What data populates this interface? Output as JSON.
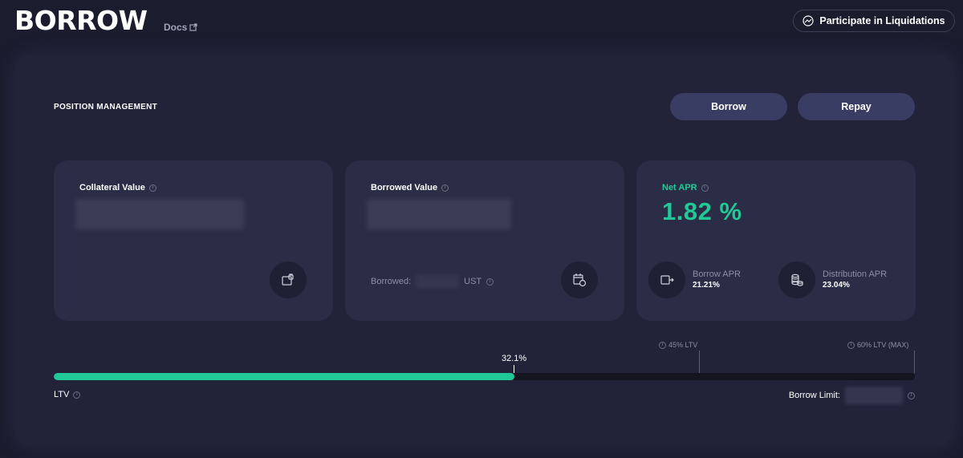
{
  "header": {
    "title": "BORROW",
    "docs_label": "Docs",
    "liquidations_label": "Participate in Liquidations"
  },
  "section": {
    "title": "POSITION MANAGEMENT"
  },
  "actions": {
    "borrow": "Borrow",
    "repay": "Repay"
  },
  "cards": {
    "collateral": {
      "label": "Collateral Value"
    },
    "borrowed": {
      "label": "Borrowed Value",
      "borrowed_prefix": "Borrowed:",
      "unit": "UST"
    },
    "net_apr": {
      "label": "Net APR",
      "value": "1.82 %",
      "borrow_apr_label": "Borrow APR",
      "borrow_apr_value": "21.21%",
      "distribution_apr_label": "Distribution APR",
      "distribution_apr_value": "23.04%"
    }
  },
  "ltv_bar": {
    "current_label": "32.1%",
    "current_fraction": 0.535,
    "marker_45": "45% LTV",
    "marker_60": "60% LTV (MAX)",
    "ltv_label": "LTV",
    "borrow_limit_label": "Borrow Limit:"
  },
  "colors": {
    "accent": "#20c997",
    "button": "#3a3d63",
    "card": "#2b2c45"
  }
}
